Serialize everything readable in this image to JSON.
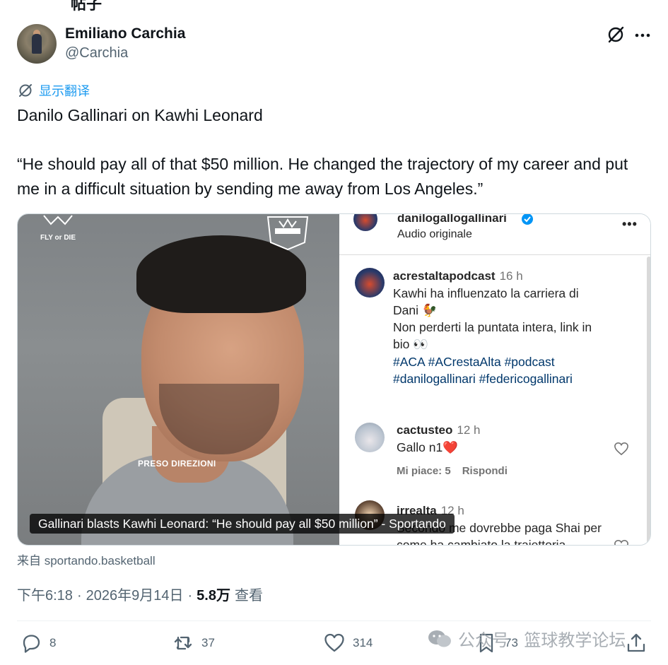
{
  "top_crop_text": "帖子",
  "author": {
    "display_name": "Emiliano Carchia",
    "handle": "@Carchia"
  },
  "translate_label": "显示翻译",
  "tweet": {
    "line1": "Danilo Gallinari on Kawhi Leonard",
    "quote": "“He should pay all of that $50 million. He changed the trajectory of my career and put me in a difficult situation by sending me away from Los Angeles.”"
  },
  "media": {
    "caption_pill": "Gallinari blasts Kawhi Leonard: “He should pay all $50 million” - Sportando",
    "video_caption": "PRESO DIREZIONI",
    "video_logo_left": "FLY or DIE",
    "instagram": {
      "post_user": "danilogallogallinari",
      "post_sub": "Audio originale",
      "comment1": {
        "user": "acrestaltapodcast",
        "time": "16 h",
        "line1": "Kawhi ha influenzato la carriera di",
        "line2": "Dani 🐓",
        "line3": "Non perderti la puntata intera, link in",
        "line4": "bio 👀",
        "tags1": "#ACA #ACrestaAlta #podcast",
        "tags2": "#danilogallinari #federicogallinari"
      },
      "comment2": {
        "user": "cactusteo",
        "time": "12 h",
        "text": "Gallo n1❤️",
        "likes": "Mi piace: 5",
        "reply": "Rispondi"
      },
      "comment3": {
        "user": "irrealta",
        "time": "12 h",
        "line1": "Secondo me dovrebbe paga Shai per",
        "line2": "come ha cambiato la traiettoria"
      }
    }
  },
  "source": "来自 sportando.basketball",
  "meta": {
    "time": "下午6:18",
    "date": "2026年9月14日",
    "views_count": "5.8万",
    "views_label": "查看",
    "sep": "·"
  },
  "actions": {
    "replies": "8",
    "reposts": "37",
    "likes": "314",
    "bookmarks": "73"
  },
  "watermark": "公众号 · 篮球教学论坛",
  "colors": {
    "accent": "#1d9bf0",
    "text_primary": "#0f1419",
    "text_secondary": "#536471",
    "ig_link": "#00376b",
    "ig_heart_red": "#ed4956"
  }
}
